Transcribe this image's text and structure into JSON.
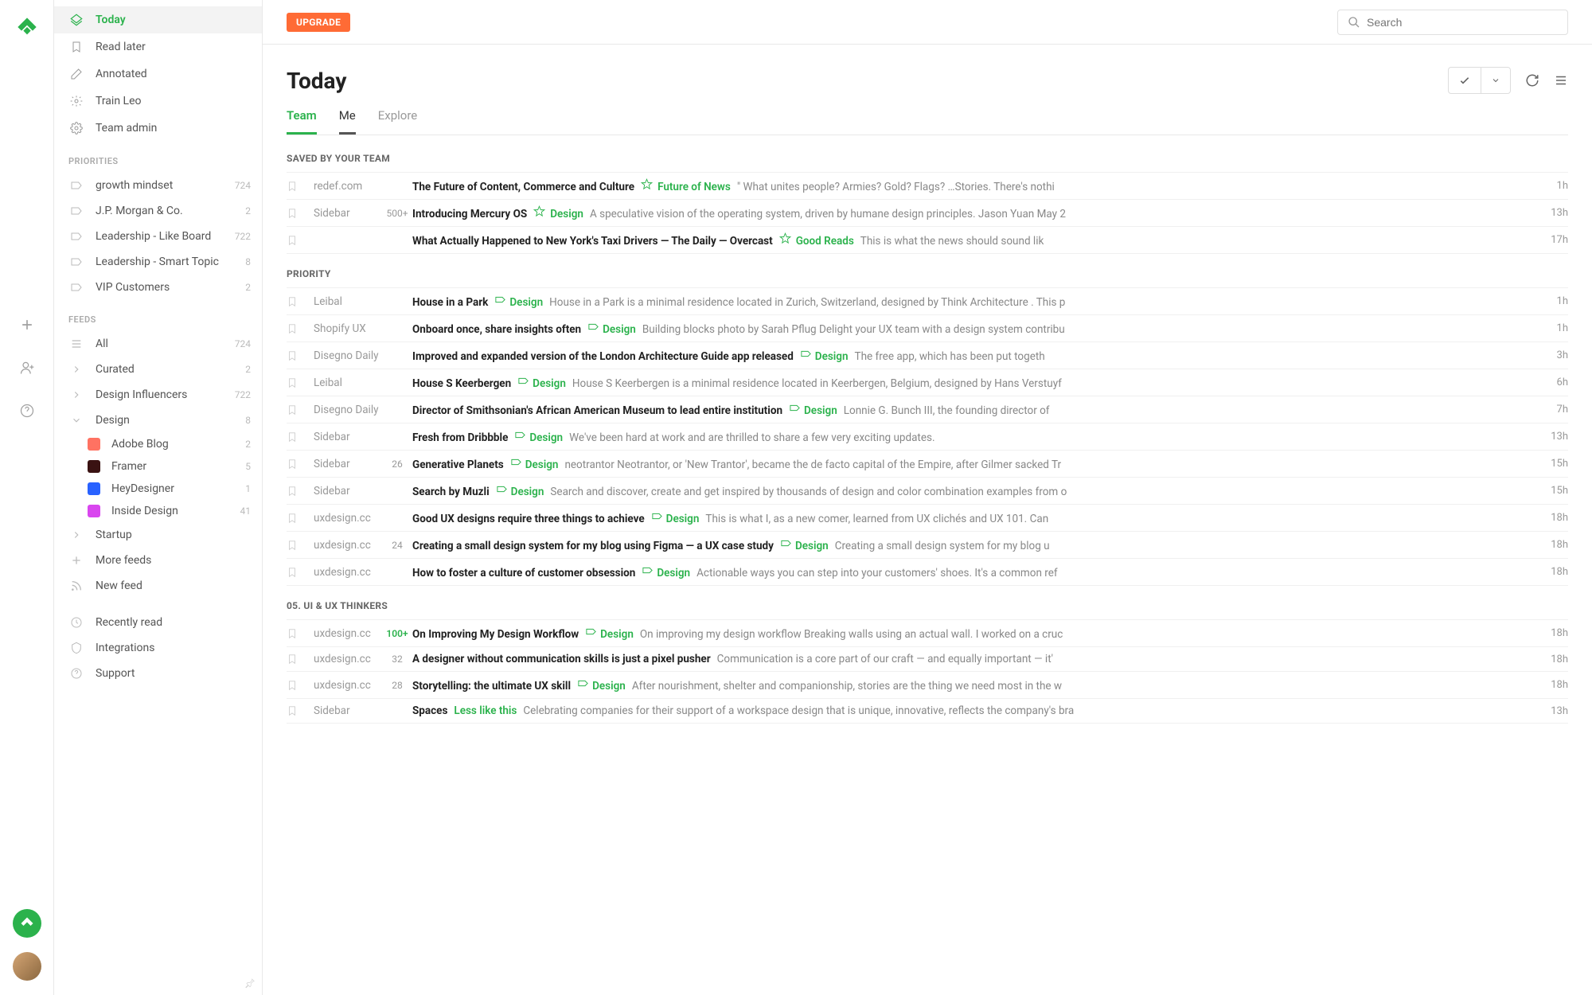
{
  "topbar": {
    "upgrade": "UPGRADE",
    "searchPlaceholder": "Search"
  },
  "pageTitle": "Today",
  "tabs": [
    {
      "label": "Team",
      "state": "active"
    },
    {
      "label": "Me",
      "state": "dark"
    },
    {
      "label": "Explore",
      "state": ""
    }
  ],
  "nav": [
    {
      "icon": "today",
      "label": "Today",
      "active": true
    },
    {
      "icon": "bookmark",
      "label": "Read later"
    },
    {
      "icon": "pencil",
      "label": "Annotated"
    },
    {
      "icon": "brain",
      "label": "Train Leo"
    },
    {
      "icon": "team",
      "label": "Team admin"
    }
  ],
  "sections": {
    "priorities": {
      "title": "PRIORITIES",
      "items": [
        {
          "label": "growth mindset",
          "count": "724"
        },
        {
          "label": "J.P. Morgan & Co.",
          "count": "2"
        },
        {
          "label": "Leadership - Like Board",
          "count": "722"
        },
        {
          "label": "Leadership - Smart Topic",
          "count": "8"
        },
        {
          "label": "VIP Customers",
          "count": "2"
        }
      ]
    },
    "feeds": {
      "title": "FEEDS",
      "items": [
        {
          "icon": "lines",
          "label": "All",
          "count": "724"
        },
        {
          "icon": "chev",
          "label": "Curated",
          "count": "2"
        },
        {
          "icon": "chev",
          "label": "Design Influencers",
          "count": "722"
        },
        {
          "icon": "chevdown",
          "label": "Design",
          "count": "8",
          "children": [
            {
              "color": "#ff7262",
              "label": "Adobe Blog",
              "count": "2"
            },
            {
              "color": "#3a1212",
              "label": "Framer",
              "count": "5"
            },
            {
              "color": "#2962ff",
              "label": "HeyDesigner",
              "count": "1"
            },
            {
              "color": "#d946ef",
              "label": "Inside Design",
              "count": "41"
            }
          ]
        },
        {
          "icon": "chev",
          "label": "Startup",
          "count": ""
        },
        {
          "icon": "plus",
          "label": "More feeds",
          "count": ""
        },
        {
          "icon": "rss",
          "label": "New feed",
          "count": ""
        }
      ]
    },
    "footer": [
      {
        "icon": "clock",
        "label": "Recently read"
      },
      {
        "icon": "shield",
        "label": "Integrations"
      },
      {
        "icon": "help",
        "label": "Support"
      }
    ]
  },
  "groups": [
    {
      "title": "SAVED BY YOUR TEAM",
      "articles": [
        {
          "src": "redef.com",
          "cnt": "",
          "title": "The Future of Content, Commerce and Culture",
          "tag": "Future of News",
          "tagType": "star",
          "excerpt": "\" What unites people? Armies? Gold? Flags? …Stories. There's nothi",
          "time": "1h"
        },
        {
          "src": "Sidebar",
          "cnt": "500+",
          "title": "Introducing Mercury OS",
          "tag": "Design",
          "tagType": "star",
          "excerpt": "A speculative vision of the operating system, driven by humane design principles. Jason Yuan May 2",
          "time": "13h"
        },
        {
          "src": "",
          "cnt": "",
          "title": "What Actually Happened to New York's Taxi Drivers — The Daily — Overcast",
          "tag": "Good Reads",
          "tagType": "star",
          "excerpt": "This is what the news should sound lik",
          "time": "17h"
        }
      ]
    },
    {
      "title": "PRIORITY",
      "articles": [
        {
          "src": "Leibal",
          "cnt": "",
          "title": "House in a Park",
          "tag": "Design",
          "tagType": "label",
          "excerpt": "House in a Park is a minimal residence located in Zurich, Switzerland, designed by Think Architecture . This p",
          "time": "1h"
        },
        {
          "src": "Shopify UX",
          "cnt": "",
          "title": "Onboard once, share insights often",
          "tag": "Design",
          "tagType": "label",
          "excerpt": "Building blocks photo by Sarah Pflug Delight your UX team with a design system contribu",
          "time": "1h"
        },
        {
          "src": "Disegno Daily",
          "cnt": "",
          "title": "Improved and expanded version of the London Architecture Guide app released",
          "tag": "Design",
          "tagType": "label",
          "excerpt": "The free app, which has been put togeth",
          "time": "3h"
        },
        {
          "src": "Leibal",
          "cnt": "",
          "title": "House S Keerbergen",
          "tag": "Design",
          "tagType": "label",
          "excerpt": "House S Keerbergen is a minimal residence located in Keerbergen, Belgium, designed by Hans Verstuyf",
          "time": "6h"
        },
        {
          "src": "Disegno Daily",
          "cnt": "",
          "title": "Director of Smithsonian's African American Museum to lead entire institution",
          "tag": "Design",
          "tagType": "label",
          "excerpt": "Lonnie G. Bunch III, the founding director of",
          "time": "7h"
        },
        {
          "src": "Sidebar",
          "cnt": "",
          "title": "Fresh from Dribbble",
          "tag": "Design",
          "tagType": "label",
          "excerpt": "We've been hard at work and are thrilled to share a few very exciting updates.",
          "time": "13h"
        },
        {
          "src": "Sidebar",
          "cnt": "26",
          "title": "Generative Planets",
          "tag": "Design",
          "tagType": "label",
          "excerpt": "neotrantor Neotrantor, or 'New Trantor', became the de facto capital of the Empire, after Gilmer sacked Tr",
          "time": "15h"
        },
        {
          "src": "Sidebar",
          "cnt": "",
          "title": "Search by Muzli",
          "tag": "Design",
          "tagType": "label",
          "excerpt": "Search and discover, create and get inspired by thousands of design and color combination examples from o",
          "time": "15h"
        },
        {
          "src": "uxdesign.cc",
          "cnt": "",
          "title": "Good UX designs require three things to achieve",
          "tag": "Design",
          "tagType": "label",
          "excerpt": "This is what I, as a new comer, learned from UX clichés and UX 101. Can",
          "time": "18h"
        },
        {
          "src": "uxdesign.cc",
          "cnt": "24",
          "title": "Creating a small design system for my blog using Figma — a UX case study",
          "tag": "Design",
          "tagType": "label",
          "excerpt": "Creating a small design system for my blog u",
          "time": "18h"
        },
        {
          "src": "uxdesign.cc",
          "cnt": "",
          "title": "How to foster a culture of customer obsession",
          "tag": "Design",
          "tagType": "label",
          "excerpt": "Actionable ways you can step into your customers' shoes. It's a common ref",
          "time": "18h"
        }
      ]
    },
    {
      "title": "05. UI & UX THINKERS",
      "articles": [
        {
          "src": "uxdesign.cc",
          "cnt": "100+",
          "title": "On Improving My Design Workflow",
          "tag": "Design",
          "tagType": "label",
          "excerpt": "On improving my design workflow Breaking walls using an actual wall. I worked on a cruc",
          "time": "18h",
          "cntGreen": true
        },
        {
          "src": "uxdesign.cc",
          "cnt": "32",
          "title": "A designer without communication skills is just a pixel pusher",
          "tag": "",
          "tagType": "",
          "excerpt": "Communication is a core part of our craft — and equally important — it'",
          "time": "18h"
        },
        {
          "src": "uxdesign.cc",
          "cnt": "28",
          "title": "Storytelling: the ultimate UX skill",
          "tag": "Design",
          "tagType": "label",
          "excerpt": "After nourishment, shelter and companionship, stories are the thing we need most in the w",
          "time": "18h"
        },
        {
          "src": "Sidebar",
          "cnt": "",
          "title": "Spaces",
          "tag": "Less like this",
          "tagType": "less",
          "excerpt": "Celebrating companies for their support of a workspace design that is unique, innovative, reflects the company's bra",
          "time": "13h"
        }
      ]
    }
  ]
}
